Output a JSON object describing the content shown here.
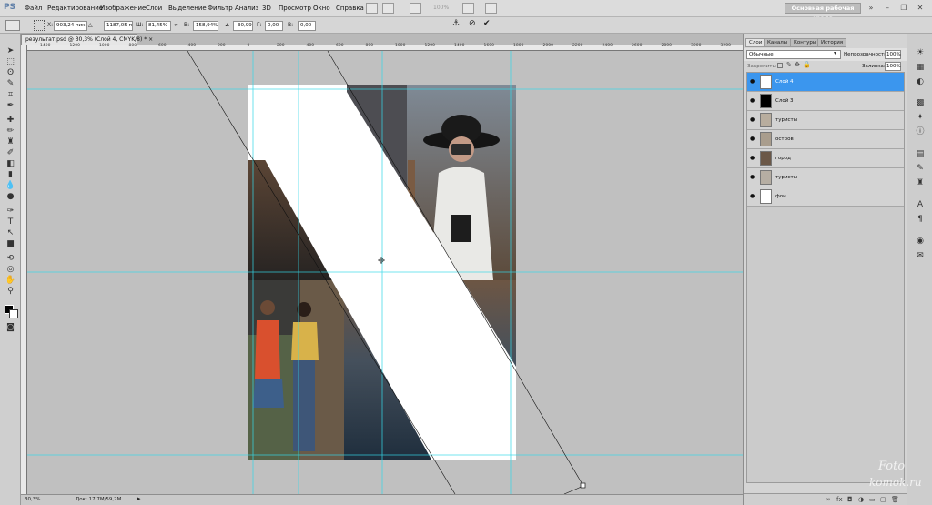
{
  "app": {
    "logo": "PS",
    "zoom_display": "100%"
  },
  "menu": [
    "Файл",
    "Редактирование",
    "Изображение",
    "Слои",
    "Выделение",
    "Фильтр",
    "Анализ",
    "3D",
    "Просмотр",
    "Окно",
    "Справка"
  ],
  "workspace_button": "Основная рабочая среда",
  "options": {
    "x_label": "X:",
    "x_value": "903,24 пикс",
    "y_value": "1187,05 пикс",
    "w_label": "Ш:",
    "w_value": "81,45%",
    "h_label": "В:",
    "h_value": "158,94%",
    "angle_value": "-30,99",
    "hskew_label": "Г:",
    "hskew_value": "0,00",
    "vskew_label": "В:",
    "vskew_value": "0,00",
    "cancel_icon": "cancel-icon",
    "commit_icon": "check-icon"
  },
  "document": {
    "tab_title": "результат.psd @ 30,3% (Слой 4, CMYK/8) *",
    "status_zoom": "30,3%",
    "status_doc": "Док: 17,7M/59,2M"
  },
  "rulers": {
    "top": [
      "1400",
      "1200",
      "1000",
      "800",
      "600",
      "400",
      "200",
      "0",
      "200",
      "400",
      "600",
      "800",
      "1000",
      "1200",
      "1400",
      "1600",
      "1800",
      "2000",
      "2200",
      "2400",
      "2600",
      "2800",
      "3000",
      "3200",
      "3400",
      "3600",
      "3800"
    ]
  },
  "panel": {
    "tabs": [
      "Слои",
      "Каналы",
      "Контуры",
      "История"
    ],
    "blend_mode": "Обычные",
    "opacity_label": "Непрозрачность:",
    "opacity_value": "100%",
    "lock_label": "Закрепить:",
    "fill_label": "Заливка:",
    "fill_value": "100%",
    "layers": [
      {
        "name": "Слой 4",
        "selected": true,
        "thumb": "white"
      },
      {
        "name": "Слой 3",
        "selected": false,
        "thumb": "black"
      },
      {
        "name": "туристы",
        "selected": false,
        "thumb": "photo"
      },
      {
        "name": "остров",
        "selected": false,
        "thumb": "photo"
      },
      {
        "name": "город",
        "selected": false,
        "thumb": "photo"
      },
      {
        "name": "туристы",
        "selected": false,
        "thumb": "photo"
      },
      {
        "name": "фон",
        "selected": false,
        "thumb": "white"
      }
    ]
  },
  "watermark": {
    "line1": "Foto",
    "line2": "komok.ru"
  },
  "colors": {
    "selection": "#3b96ee",
    "guide": "#35d8e8",
    "canvas_bg": "#c0c0c0"
  }
}
